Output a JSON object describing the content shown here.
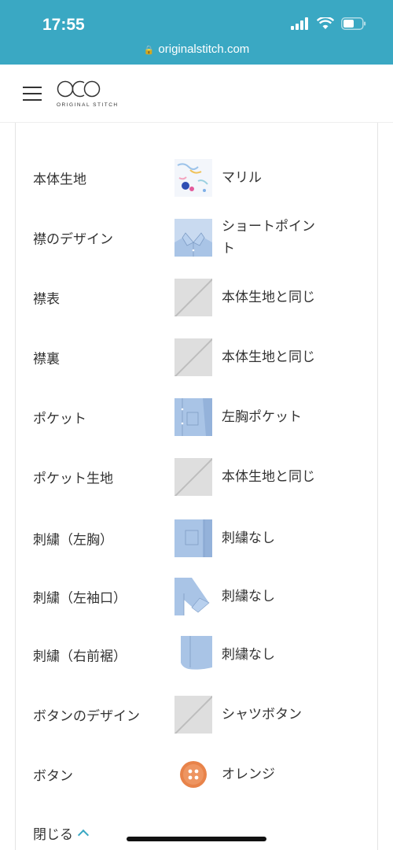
{
  "status_bar": {
    "time": "17:55",
    "url": "originalstitch.com"
  },
  "header": {
    "logo_text": "ORIGINAL STITCH"
  },
  "options": [
    {
      "label": "本体生地",
      "value": "マリル",
      "icon": "fabric-swatch"
    },
    {
      "label": "襟のデザイン",
      "value": "ショートポイント",
      "icon": "collar-image"
    },
    {
      "label": "襟表",
      "value": "本体生地と同じ",
      "icon": "placeholder-image"
    },
    {
      "label": "襟裏",
      "value": "本体生地と同じ",
      "icon": "placeholder-image"
    },
    {
      "label": "ポケット",
      "value": "左胸ポケット",
      "icon": "pocket-image"
    },
    {
      "label": "ポケット生地",
      "value": "本体生地と同じ",
      "icon": "placeholder-image"
    },
    {
      "label": "刺繍（左胸）",
      "value": "刺繍なし",
      "icon": "chest-image"
    },
    {
      "label": "刺繍（左袖口）",
      "value": "刺繍なし",
      "icon": "sleeve-image"
    },
    {
      "label": "刺繍（右前裾）",
      "value": "刺繍なし",
      "icon": "hem-image"
    },
    {
      "label": "ボタンのデザイン",
      "value": "シャツボタン",
      "icon": "placeholder-image"
    },
    {
      "label": "ボタン",
      "value": "オレンジ",
      "icon": "orange-button-image"
    }
  ],
  "close_label": "閉じる",
  "colors": {
    "accent": "#3aa8c3",
    "shirt_blue": "#a9c4e6",
    "button_orange": "#e8834a"
  }
}
